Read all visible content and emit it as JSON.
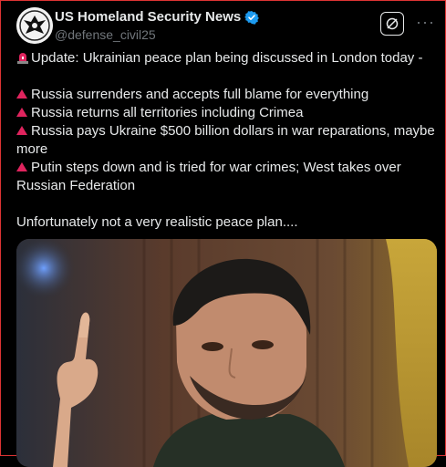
{
  "account": {
    "display_name": "US Homeland Security News",
    "handle": "@defense_civil25",
    "verified": true
  },
  "header": {
    "grok_icon": "grok-icon",
    "more_label": "···"
  },
  "tweet": {
    "lines": [
      "Update: Ukrainian peace plan being discussed in London today -",
      "Russia surrenders and accepts full blame for everything",
      "Russia returns all territories including Crimea",
      "Russia pays Ukraine $500 billion dollars in war reparations, maybe more",
      "Putin steps down and is tried for war crimes; West takes over Russian Federation",
      "Unfortunately not a very realistic peace plan...."
    ]
  },
  "colors": {
    "background": "#000000",
    "text": "#e7e9ea",
    "muted": "#71767b",
    "bullet_red": "#e0245e",
    "verified_blue": "#1d9bf0"
  }
}
